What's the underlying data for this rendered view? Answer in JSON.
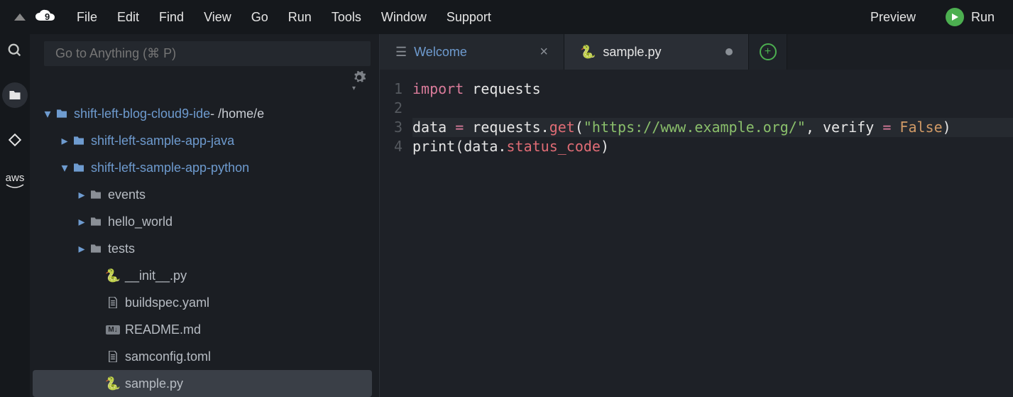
{
  "menu": {
    "items": [
      "File",
      "Edit",
      "Find",
      "View",
      "Go",
      "Run",
      "Tools",
      "Window",
      "Support"
    ],
    "preview": "Preview",
    "run": "Run"
  },
  "goto": {
    "placeholder": "Go to Anything (⌘ P)"
  },
  "tree": {
    "root": {
      "name": "shift-left-blog-cloud9-ide",
      "path": " - /home/e"
    },
    "java": "shift-left-sample-app-java",
    "python": "shift-left-sample-app-python",
    "events": "events",
    "hello": "hello_world",
    "tests": "tests",
    "init": "__init__.py",
    "buildspec": "buildspec.yaml",
    "readme": "README.md",
    "samconfig": "samconfig.toml",
    "sample": "sample.py"
  },
  "tabs": {
    "welcome": "Welcome",
    "sample": "sample.py"
  },
  "code": {
    "ln": [
      "1",
      "2",
      "3",
      "4"
    ],
    "l1": {
      "kw": "import",
      "mod": " requests"
    },
    "l3": {
      "a": "data ",
      "op": "=",
      "b": " requests.",
      "fn": "get",
      "p1": "(",
      "str": "\"https://www.example.org/\"",
      "c": ", verify ",
      "op2": "=",
      "sp": " ",
      "const": "False",
      "p2": ")"
    },
    "l4": {
      "a": "print",
      "p1": "(",
      "b": "data.",
      "attr": "status_code",
      "p2": ")"
    }
  }
}
